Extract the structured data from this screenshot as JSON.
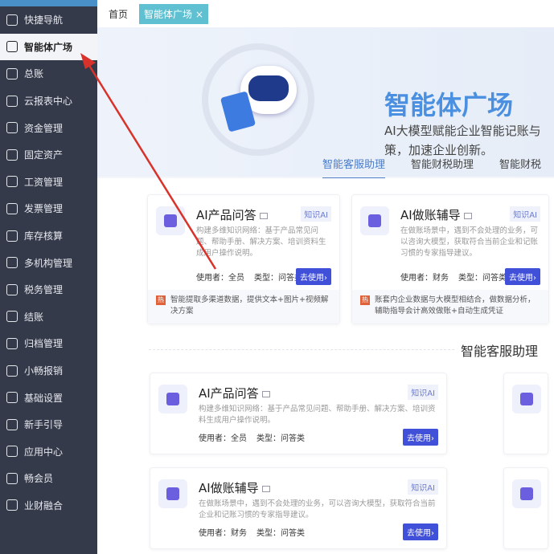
{
  "sidebar": {
    "items": [
      "快捷导航",
      "智能体广场",
      "总账",
      "云报表中心",
      "资金管理",
      "固定资产",
      "工资管理",
      "发票管理",
      "库存核算",
      "多机构管理",
      "税务管理",
      "结账",
      "归档管理",
      "小畅报销",
      "基础设置",
      "新手引导",
      "应用中心",
      "畅会员",
      "业财融合"
    ],
    "active_index": 1
  },
  "tabs": {
    "home": "首页",
    "current": "智能体广场",
    "close": "×"
  },
  "hero": {
    "title": "智能体广场",
    "subtitle_1": "AI大模型赋能企业智能记账与",
    "subtitle_2": "策，加速企业创新。"
  },
  "categories": [
    "智能客服助理",
    "智能财税助理",
    "智能财税"
  ],
  "featured": [
    {
      "title": "AI产品问答",
      "tag": "知识AI",
      "desc": "构建多维知识网络：基于产品常见问题、帮助手册、解决方案、培训资料生成用户操作说明。",
      "user": "使用者：全员",
      "type": "类型：问答类",
      "button": "去使用›",
      "hot_label": "热",
      "hot": "智能提取多渠道数据，提供文本+图片+视频解决方案"
    },
    {
      "title": "AI做账辅导",
      "tag": "知识AI",
      "desc": "在做账场景中，遇到不会处理的业务，可以咨询大模型，获取符合当前企业和记账习惯的专家指导建议。",
      "user": "使用者：财务",
      "type": "类型：问答类",
      "button": "去使用›",
      "hot_label": "热",
      "hot": "账套内企业数据与大模型相结合，做数据分析，辅助指导会计高效做账+自动生成凭证"
    }
  ],
  "section_title": "智能客服助理",
  "list": [
    {
      "title": "AI产品问答",
      "tag": "知识AI",
      "desc": "构建多维知识网络：基于产品常见问题、帮助手册、解决方案、培训资料生成用户操作说明。",
      "user": "使用者：全员",
      "type": "类型：问答类",
      "button": "去使用›"
    },
    {
      "title": "AI做账辅导",
      "tag": "知识AI",
      "desc": "在做账场景中，遇到不会处理的业务，可以咨询大模型，获取符合当前企业和记账习惯的专家指导建议。",
      "user": "使用者：财务",
      "type": "类型：问答类",
      "button": "去使用›"
    }
  ]
}
